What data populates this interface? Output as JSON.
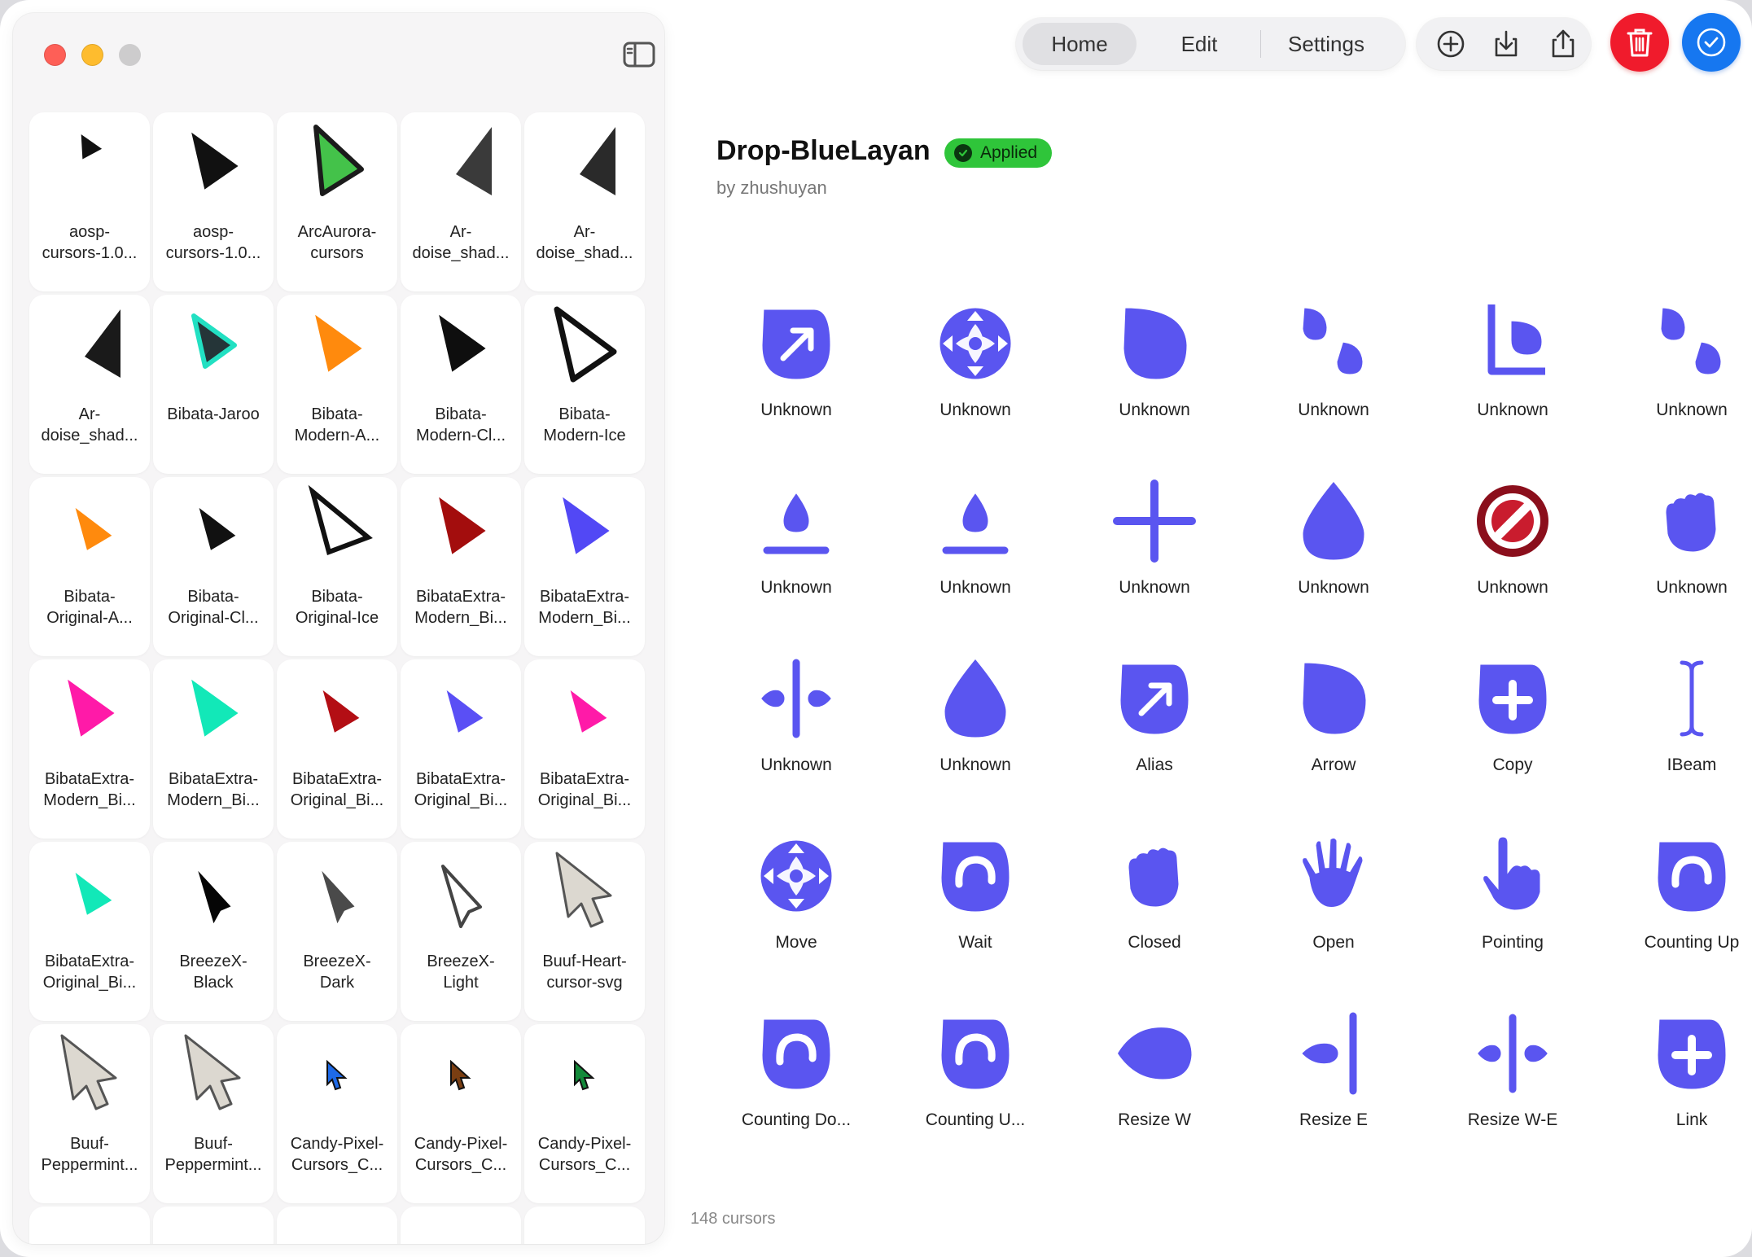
{
  "window": {
    "traffic_lights": [
      "close",
      "minimize",
      "maximize"
    ],
    "sidebar_toggle_icon": "sidebar-toggle-icon"
  },
  "themes": [
    {
      "label": "aosp-\ncursors-1.0...",
      "color": "#111111",
      "style": "small"
    },
    {
      "label": "aosp-\ncursors-1.0...",
      "color": "#111111",
      "style": "big"
    },
    {
      "label": "ArcAurora-\ncursors",
      "color": "#44c24a",
      "style": "outlined"
    },
    {
      "label": "Ar-\ndoise_shad...",
      "color": "#3a3a3a",
      "style": "wedge"
    },
    {
      "label": "Ar-\ndoise_shad...",
      "color": "#2a2a2a",
      "style": "wedge"
    },
    {
      "label": "Ar-\ndoise_shad...",
      "color": "#1a1a1a",
      "style": "wedge"
    },
    {
      "label": "Bibata-Jaroo",
      "color": "#253538",
      "style": "teal"
    },
    {
      "label": "Bibata-\nModern-A...",
      "color": "#ff8a0d",
      "style": "big"
    },
    {
      "label": "Bibata-\nModern-Cl...",
      "color": "#0e0e0e",
      "style": "big"
    },
    {
      "label": "Bibata-\nModern-Ice",
      "color": "#ffffff",
      "style": "ice"
    },
    {
      "label": "Bibata-\nOriginal-A...",
      "color": "#ff8a0d",
      "style": "sharp"
    },
    {
      "label": "Bibata-\nOriginal-Cl...",
      "color": "#111111",
      "style": "sharp"
    },
    {
      "label": "Bibata-\nOriginal-Ice",
      "color": "#ffffff",
      "style": "ice-sharp"
    },
    {
      "label": "BibataExtra-\nModern_Bi...",
      "color": "#a30d0d",
      "style": "big"
    },
    {
      "label": "BibataExtra-\nModern_Bi...",
      "color": "#5248f5",
      "style": "big"
    },
    {
      "label": "BibataExtra-\nModern_Bi...",
      "color": "#ff1aa8",
      "style": "big"
    },
    {
      "label": "BibataExtra-\nModern_Bi...",
      "color": "#12e8b8",
      "style": "big"
    },
    {
      "label": "BibataExtra-\nOriginal_Bi...",
      "color": "#b30e14",
      "style": "sharp"
    },
    {
      "label": "BibataExtra-\nOriginal_Bi...",
      "color": "#5a4ff5",
      "style": "sharp"
    },
    {
      "label": "BibataExtra-\nOriginal_Bi...",
      "color": "#ff1aa8",
      "style": "sharp"
    },
    {
      "label": "BibataExtra-\nOriginal_Bi...",
      "color": "#12e8b8",
      "style": "sharp"
    },
    {
      "label": "BreezeX-\nBlack",
      "color": "#050505",
      "style": "breeze"
    },
    {
      "label": "BreezeX-\nDark",
      "color": "#4a4a4a",
      "style": "breeze"
    },
    {
      "label": "BreezeX-\nLight",
      "color": "#ffffff",
      "style": "breeze-light"
    },
    {
      "label": "Buuf-Heart-\ncursor-svg",
      "color": "#d8d4cc",
      "style": "buuf"
    },
    {
      "label": "Buuf-\nPeppermint...",
      "color": "#d8d4cc",
      "style": "buuf"
    },
    {
      "label": "Buuf-\nPeppermint...",
      "color": "#d8d4cc",
      "style": "buuf"
    },
    {
      "label": "Candy-Pixel-\nCursors_C...",
      "color": "#1e6ae8",
      "style": "pixel"
    },
    {
      "label": "Candy-Pixel-\nCursors_C...",
      "color": "#7a3e12",
      "style": "pixel"
    },
    {
      "label": "Candy-Pixel-\nCursors_C...",
      "color": "#138a3a",
      "style": "pixel"
    }
  ],
  "toolbar": {
    "tabs": [
      {
        "label": "Home",
        "active": true
      },
      {
        "label": "Edit",
        "active": false
      },
      {
        "label": "Settings",
        "active": false
      }
    ],
    "tools": [
      "add-icon",
      "download-icon",
      "share-icon"
    ],
    "trash_icon": "trash-icon",
    "apply_icon": "checkmark-icon",
    "trash_color": "#f01b2c",
    "apply_color": "#1677f0"
  },
  "theme": {
    "title": "Drop-BlueLayan",
    "status": "Applied",
    "status_color": "#2fc53a",
    "author": "by zhushuyan",
    "accent": "#5a55f0"
  },
  "cursors": [
    {
      "label": "Unknown",
      "icon": "alias-drop"
    },
    {
      "label": "Unknown",
      "icon": "move"
    },
    {
      "label": "Unknown",
      "icon": "drop"
    },
    {
      "label": "Unknown",
      "icon": "two-drops"
    },
    {
      "label": "Unknown",
      "icon": "corner-drop"
    },
    {
      "label": "Unknown",
      "icon": "two-drops"
    },
    {
      "label": "Unknown",
      "icon": "drop-bar"
    },
    {
      "label": "Unknown",
      "icon": "drop-bar"
    },
    {
      "label": "Unknown",
      "icon": "crosshair"
    },
    {
      "label": "Unknown",
      "icon": "tear"
    },
    {
      "label": "Unknown",
      "icon": "not-allowed"
    },
    {
      "label": "Unknown",
      "icon": "closed-hand"
    },
    {
      "label": "Unknown",
      "icon": "split-h"
    },
    {
      "label": "Unknown",
      "icon": "tear"
    },
    {
      "label": "Alias",
      "icon": "alias-drop"
    },
    {
      "label": "Arrow",
      "icon": "drop"
    },
    {
      "label": "Copy",
      "icon": "copy-drop"
    },
    {
      "label": "IBeam",
      "icon": "ibeam"
    },
    {
      "label": "Move",
      "icon": "move"
    },
    {
      "label": "Wait",
      "icon": "wait"
    },
    {
      "label": "Closed",
      "icon": "closed-hand"
    },
    {
      "label": "Open",
      "icon": "open-hand"
    },
    {
      "label": "Pointing",
      "icon": "pointing-hand"
    },
    {
      "label": "Counting Up",
      "icon": "wait"
    },
    {
      "label": "Counting Do...",
      "icon": "wait"
    },
    {
      "label": "Counting U...",
      "icon": "wait"
    },
    {
      "label": "Resize W",
      "icon": "resize-w"
    },
    {
      "label": "Resize E",
      "icon": "resize-e"
    },
    {
      "label": "Resize W-E",
      "icon": "split-h"
    },
    {
      "label": "Link",
      "icon": "copy-drop"
    }
  ],
  "footer": {
    "count": "148 cursors"
  }
}
